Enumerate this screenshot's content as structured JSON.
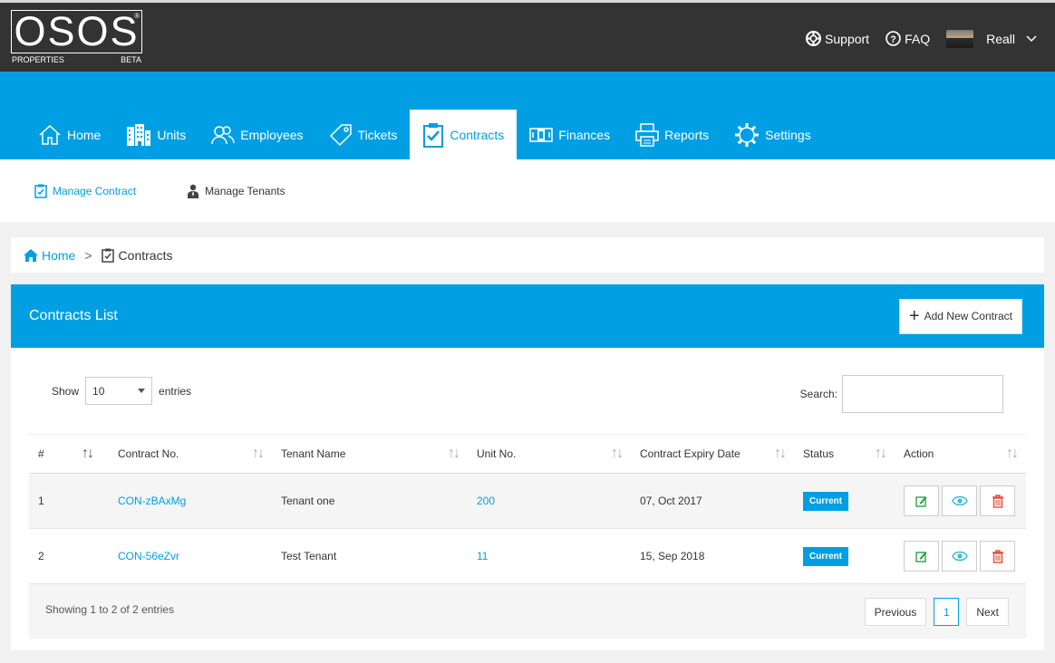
{
  "brand": {
    "name": "OSOS",
    "reg_mark": "®",
    "sub_left": "PROPERTIES",
    "sub_right": "BETA"
  },
  "top_links": {
    "support": "Support",
    "faq": "FAQ",
    "user": "Reall"
  },
  "nav": [
    {
      "label": "Home",
      "icon": "home-icon"
    },
    {
      "label": "Units",
      "icon": "building-icon"
    },
    {
      "label": "Employees",
      "icon": "users-icon"
    },
    {
      "label": "Tickets",
      "icon": "tag-icon"
    },
    {
      "label": "Contracts",
      "icon": "clipboard-check-icon",
      "active": true
    },
    {
      "label": "Finances",
      "icon": "money-icon"
    },
    {
      "label": "Reports",
      "icon": "printer-icon"
    },
    {
      "label": "Settings",
      "icon": "gear-icon"
    }
  ],
  "subnav": {
    "manage_contract": "Manage Contract",
    "manage_tenants": "Manage Tenants"
  },
  "breadcrumb": {
    "home": "Home",
    "sep": ">",
    "current": "Contracts"
  },
  "panel": {
    "title": "Contracts List",
    "add_label": "Add New Contract"
  },
  "controls": {
    "show": "Show",
    "entries_value": "10",
    "entries": "entries",
    "search": "Search:"
  },
  "table": {
    "headers": [
      "#",
      "Contract No.",
      "Tenant Name",
      "Unit No.",
      "Contract Expiry Date",
      "Status",
      "Action"
    ],
    "rows": [
      {
        "num": "1",
        "contract": "CON-zBAxMg",
        "tenant": "Tenant one",
        "unit": "200",
        "expiry": "07, Oct 2017",
        "status": "Current"
      },
      {
        "num": "2",
        "contract": "CON-56eZvr",
        "tenant": "Test Tenant",
        "unit": "11",
        "expiry": "15, Sep 2018",
        "status": "Current"
      }
    ]
  },
  "footer": {
    "info": "Showing 1 to 2 of 2 entries",
    "prev": "Previous",
    "page": "1",
    "next": "Next"
  },
  "colors": {
    "accent": "#009fe3",
    "topbar": "#333333",
    "edit": "#2aa24b",
    "view": "#3bb8db",
    "delete": "#e34b3b"
  }
}
